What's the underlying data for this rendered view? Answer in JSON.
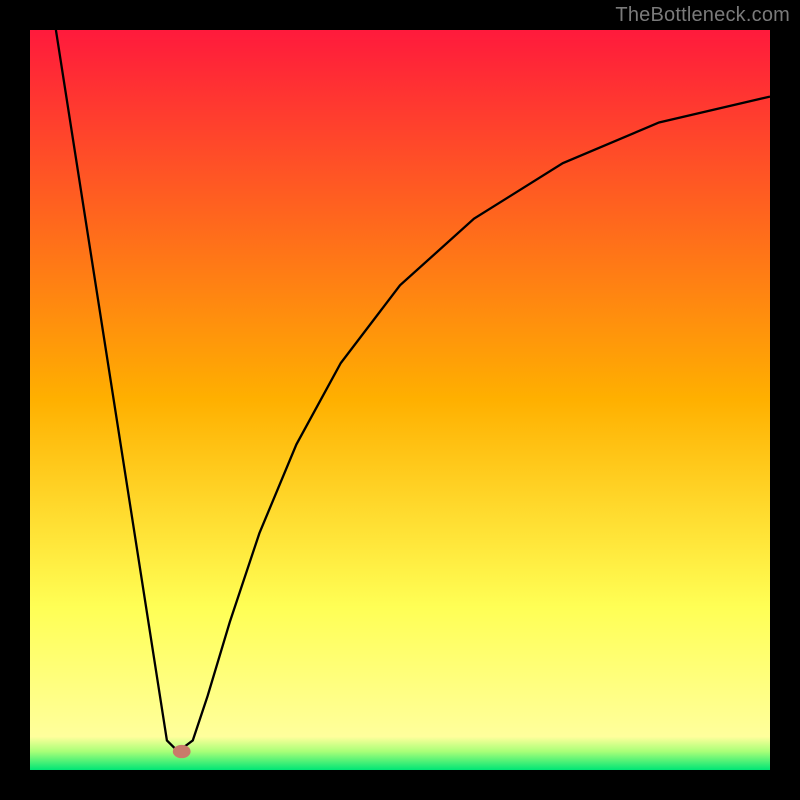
{
  "attribution": "TheBottleneck.com",
  "chart_data": {
    "type": "line",
    "title": "",
    "xlabel": "",
    "ylabel": "",
    "xlim": [
      0,
      100
    ],
    "ylim": [
      0,
      100
    ],
    "background_gradient": {
      "stops": [
        {
          "offset": 0.0,
          "color": "#ff1a3c"
        },
        {
          "offset": 0.5,
          "color": "#ffb000"
        },
        {
          "offset": 0.78,
          "color": "#ffff55"
        },
        {
          "offset": 0.955,
          "color": "#ffff9c"
        },
        {
          "offset": 0.975,
          "color": "#a8ff78"
        },
        {
          "offset": 1.0,
          "color": "#00e676"
        }
      ]
    },
    "series": [
      {
        "name": "bottleneck-curve",
        "stroke": "#000000",
        "stroke_width": 2.3,
        "points": [
          {
            "x": 3.5,
            "y": 100.0
          },
          {
            "x": 18.5,
            "y": 4.0
          },
          {
            "x": 20.0,
            "y": 2.5
          },
          {
            "x": 22.0,
            "y": 4.0
          },
          {
            "x": 24.0,
            "y": 10.0
          },
          {
            "x": 27.0,
            "y": 20.0
          },
          {
            "x": 31.0,
            "y": 32.0
          },
          {
            "x": 36.0,
            "y": 44.0
          },
          {
            "x": 42.0,
            "y": 55.0
          },
          {
            "x": 50.0,
            "y": 65.5
          },
          {
            "x": 60.0,
            "y": 74.5
          },
          {
            "x": 72.0,
            "y": 82.0
          },
          {
            "x": 85.0,
            "y": 87.5
          },
          {
            "x": 100.0,
            "y": 91.0
          }
        ]
      }
    ],
    "markers": [
      {
        "name": "selected-point",
        "x": 20.5,
        "y": 2.5,
        "rx": 1.2,
        "ry": 0.9,
        "fill": "#c97a6a"
      }
    ]
  }
}
